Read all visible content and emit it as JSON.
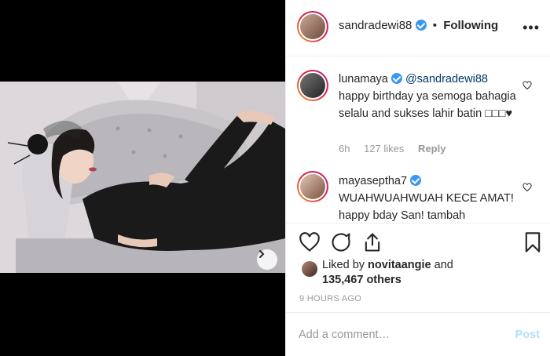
{
  "post": {
    "media": {
      "carousel_dots": 2,
      "active_dot": 1,
      "next_icon": "chevron-right-icon"
    },
    "header": {
      "username": "sandradewi88",
      "separator": "•",
      "follow_status": "Following",
      "more_label": "•••"
    },
    "comments": [
      {
        "username": "lunamaya",
        "mention": "@sandradewi88",
        "text": "happy birthday ya semoga bahagia selalu and sukses lahir batin □□□♥",
        "time": "6h",
        "likes": "127 likes",
        "reply_label": "Reply"
      },
      {
        "username": "mayasepthа7",
        "text": "WUAHWUAHWUAH KECE AMAT! happy bday San! tambah"
      }
    ],
    "actions": {
      "like_icon": "heart-icon",
      "comment_icon": "comment-icon",
      "share_icon": "share-icon",
      "save_icon": "bookmark-icon"
    },
    "liked_by": {
      "prefix": "Liked by ",
      "user": "novitaangie",
      "middle": " and",
      "count": "135,467 others"
    },
    "timestamp": "9 HOURS AGO",
    "add_comment": {
      "placeholder": "Add a comment…",
      "post_label": "Post"
    }
  },
  "colors": {
    "accent": "#3897f0",
    "post_disabled": "#b2dffc",
    "muted": "#999999",
    "mention": "#003569"
  }
}
